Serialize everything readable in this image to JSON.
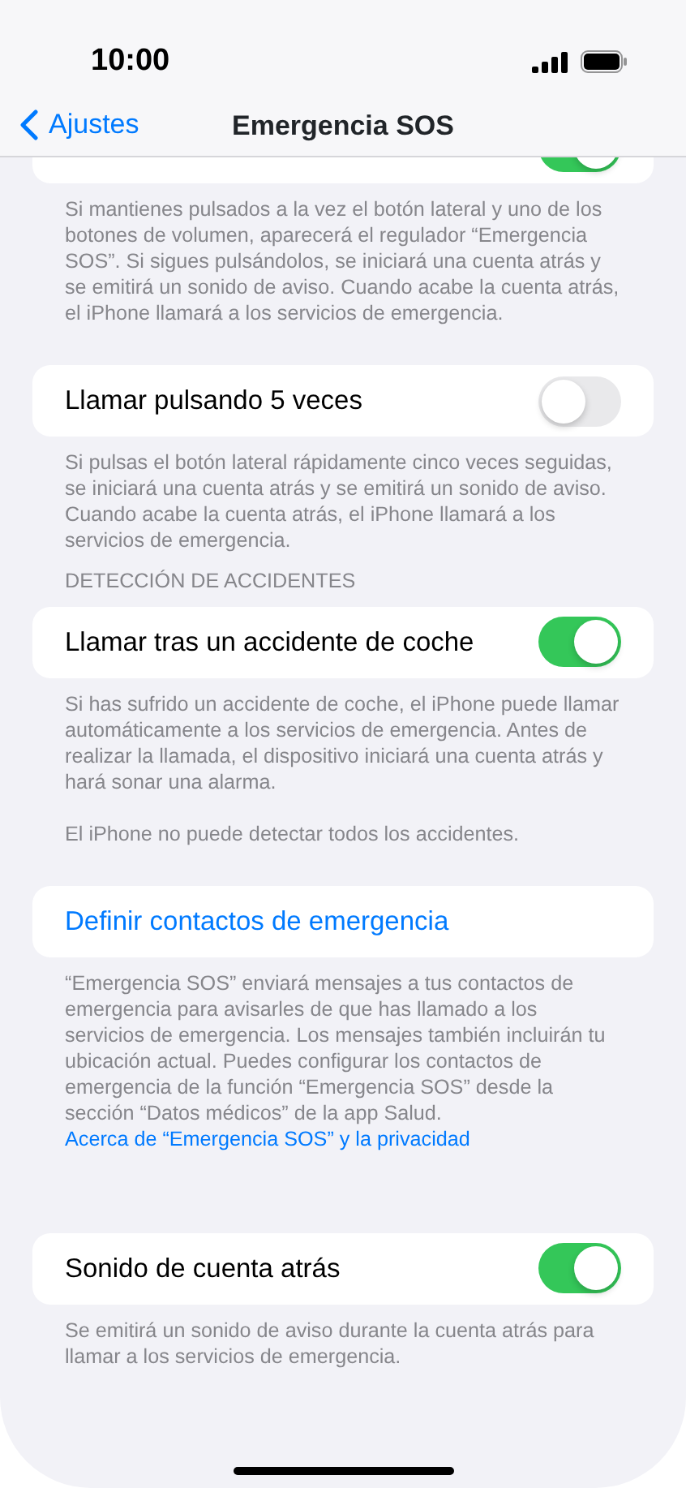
{
  "status_bar": {
    "time": "10:00"
  },
  "nav": {
    "back": "Ajustes",
    "title": "Emergencia SOS"
  },
  "sections": [
    {
      "rows": [
        {
          "kind": "toggle",
          "cut_off": true,
          "on": true
        }
      ],
      "footer": [
        "Si mantienes pulsados a la vez el botón lateral y uno de los botones de volumen, aparecerá el regulador “Emergencia SOS”. Si sigues pulsándolos, se iniciará una cuenta atrás y se emitirá un sonido de aviso. Cuando acabe la cuenta atrás, el iPhone llamará a los servicios de emergencia."
      ]
    },
    {
      "rows": [
        {
          "kind": "toggle",
          "label": "Llamar pulsando 5 veces",
          "on": false
        }
      ],
      "footer": [
        "Si pulsas el botón lateral rápidamente cinco veces seguidas, se iniciará una cuenta atrás y se emitirá un sonido de aviso. Cuando acabe la cuenta atrás, el iPhone llamará a los servicios de emergencia."
      ]
    },
    {
      "header": "DETECCIÓN DE ACCIDENTES",
      "rows": [
        {
          "kind": "toggle",
          "label": "Llamar tras un accidente de coche",
          "on": true
        }
      ],
      "footer": [
        "Si has sufrido un accidente de coche, el iPhone puede llamar automáticamente a los servicios de emergencia. Antes de realizar la llamada, el dispositivo iniciará una cuenta atrás y hará sonar una alarma.",
        "El iPhone no puede detectar todos los accidentes."
      ]
    },
    {
      "rows": [
        {
          "kind": "link",
          "label": "Definir contactos de emergencia"
        }
      ],
      "footer": [
        "“Emergencia SOS” enviará mensajes a tus contactos de emergencia para avisarles de que has llamado a los servicios de emergencia. Los mensajes también incluirán tu ubicación actual. Puedes configurar los contactos de emergencia de la función “Emergencia SOS” desde la sección “Datos médicos” de la app Salud."
      ],
      "footer_link": "Acerca de “Emergencia SOS” y la privacidad"
    },
    {
      "rows": [
        {
          "kind": "toggle",
          "label": "Sonido de cuenta atrás",
          "on": true
        }
      ],
      "footer": [
        "Se emitirá un sonido de aviso durante la cuenta atrás para llamar a los servicios de emergencia."
      ]
    }
  ]
}
